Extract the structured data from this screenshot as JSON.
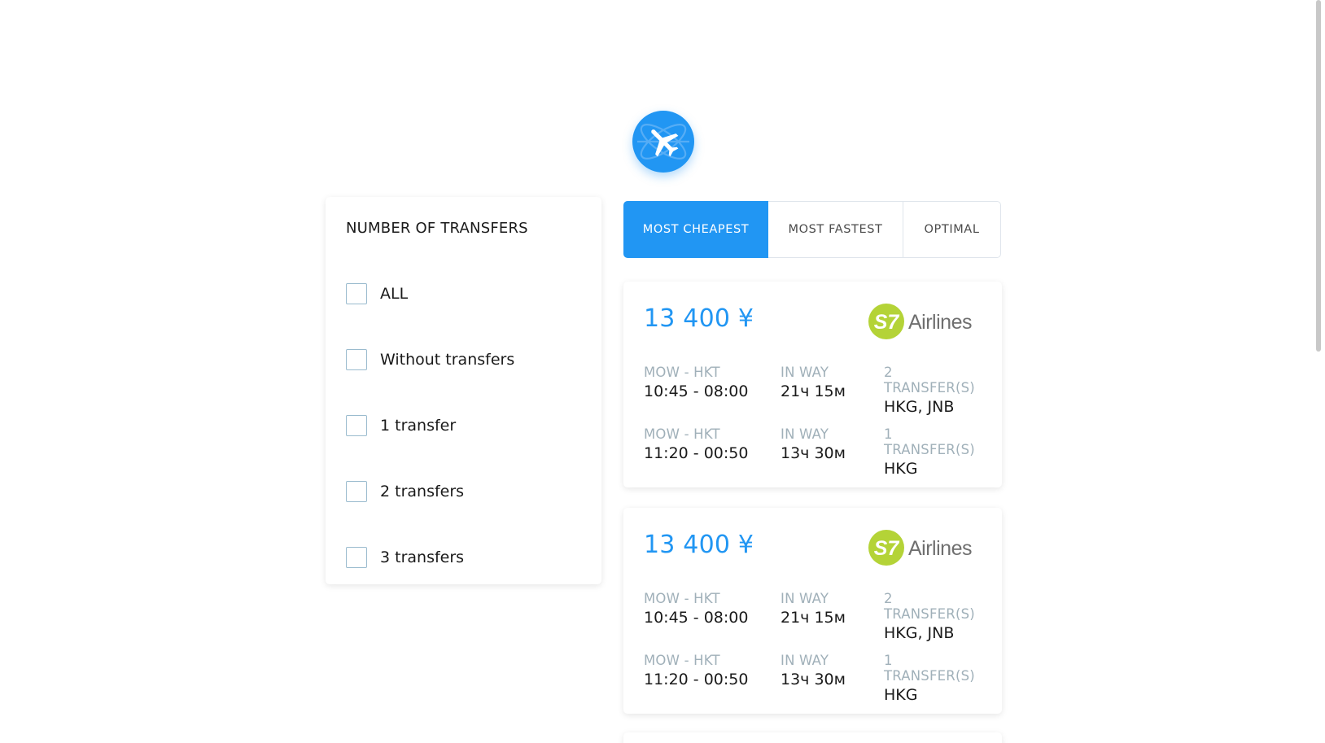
{
  "logo": {
    "icon": "airplane-globe-icon",
    "color": "#2196f3"
  },
  "filter": {
    "title": "NUMBER OF TRANSFERS",
    "options": [
      {
        "label": "ALL",
        "checked": false
      },
      {
        "label": "Without transfers",
        "checked": false
      },
      {
        "label": "1 transfer",
        "checked": false
      },
      {
        "label": "2 transfers",
        "checked": false
      },
      {
        "label": "3 transfers",
        "checked": false
      }
    ]
  },
  "tabs": [
    {
      "label": "MOST CHEAPEST",
      "active": true
    },
    {
      "label": "MOST FASTEST",
      "active": false
    },
    {
      "label": "OPTIMAL",
      "active": false
    }
  ],
  "tickets": [
    {
      "price": "13 400 ¥",
      "carrier": {
        "logo_text": "S7",
        "name": "Airlines",
        "color": "#b4d337"
      },
      "segments": [
        {
          "route": "MOW - HKT",
          "time": "10:45 - 08:00",
          "duration_label": "IN WAY",
          "duration": "21ч 15м",
          "stops_label": "2 TRANSFER(S)",
          "stops": "HKG, JNB"
        },
        {
          "route": "MOW - HKT",
          "time": "11:20 - 00:50",
          "duration_label": "IN WAY",
          "duration": "13ч 30м",
          "stops_label": "1 TRANSFER(S)",
          "stops": "HKG"
        }
      ]
    },
    {
      "price": "13 400 ¥",
      "carrier": {
        "logo_text": "S7",
        "name": "Airlines",
        "color": "#b4d337"
      },
      "segments": [
        {
          "route": "MOW - HKT",
          "time": "10:45 - 08:00",
          "duration_label": "IN WAY",
          "duration": "21ч 15м",
          "stops_label": "2 TRANSFER(S)",
          "stops": "HKG, JNB"
        },
        {
          "route": "MOW - HKT",
          "time": "11:20 - 00:50",
          "duration_label": "IN WAY",
          "duration": "13ч 30м",
          "stops_label": "1 TRANSFER(S)",
          "stops": "HKG"
        }
      ]
    }
  ],
  "colors": {
    "accent": "#2196f3",
    "muted": "#a0b0b9",
    "border": "#dfe5ec"
  }
}
